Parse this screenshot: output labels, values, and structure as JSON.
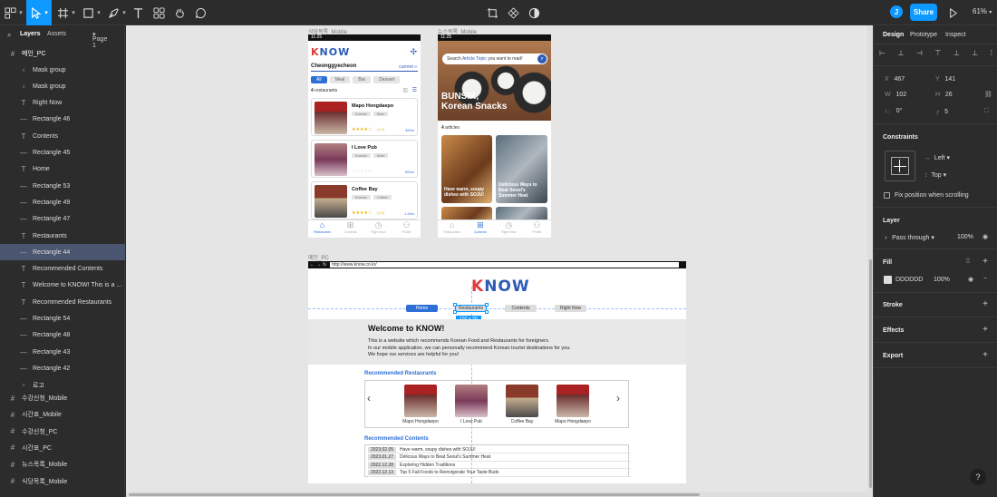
{
  "toolbar": {
    "share_label": "Share",
    "zoom": "61%",
    "avatar_letter": "J"
  },
  "left_panel": {
    "tabs": {
      "layers": "Layers",
      "assets": "Assets",
      "page": "Page 1"
    },
    "root_frame": "메인_PC",
    "layers": [
      {
        "label": "Mask group",
        "icon": "mask-icon"
      },
      {
        "label": "Mask group",
        "icon": "mask-icon"
      },
      {
        "label": "Right Now",
        "icon": "text-icon"
      },
      {
        "label": "Rectangle 46",
        "icon": "rect-icon"
      },
      {
        "label": "Contents",
        "icon": "text-icon"
      },
      {
        "label": "Rectangle 45",
        "icon": "rect-icon"
      },
      {
        "label": "Home",
        "icon": "text-icon"
      },
      {
        "label": "Rectangle 53",
        "icon": "rect-icon"
      },
      {
        "label": "Rectangle 49",
        "icon": "rect-icon"
      },
      {
        "label": "Rectangle 47",
        "icon": "rect-icon"
      },
      {
        "label": "Restaurants",
        "icon": "text-icon"
      },
      {
        "label": "Rectangle 44",
        "icon": "rect-icon",
        "selected": true
      },
      {
        "label": "Recommended Contents",
        "icon": "text-icon"
      },
      {
        "label": "Welcome to KNOW! This is a ...",
        "icon": "text-icon"
      },
      {
        "label": "Recommended Restaurants",
        "icon": "text-icon"
      },
      {
        "label": "Rectangle 54",
        "icon": "rect-icon"
      },
      {
        "label": "Rectangle 48",
        "icon": "rect-icon"
      },
      {
        "label": "Rectangle 43",
        "icon": "rect-icon"
      },
      {
        "label": "Rectangle 42",
        "icon": "rect-icon"
      },
      {
        "label": "로고",
        "icon": "mask-icon"
      }
    ],
    "frames": [
      "수강신청_Mobile",
      "시간표_Mobile",
      "수강신청_PC",
      "시간표_PC",
      "뉴스목록_Mobile",
      "식당목록_Mobile"
    ]
  },
  "canvas": {
    "mobile1_label": "식당목록_Mobile",
    "mobile2_label": "뉴스목록_Mobile",
    "pc_label": "메인_PC",
    "time": "11:25",
    "mobile1": {
      "logo": "KNOW",
      "location": "Cheonggyecheon",
      "current": "current",
      "filters": [
        "All",
        "Meal",
        "Bar",
        "Dessert"
      ],
      "count_num": "4",
      "count_text": "restaurants",
      "restaurants": [
        {
          "name": "Mapo Hongdaepo",
          "tags": [
            "Korean",
            "Beer"
          ],
          "rating": "(4.0)",
          "dist": "300m"
        },
        {
          "name": "I Love Pub",
          "tags": [
            "Korean",
            "Beer"
          ],
          "rating": "",
          "dist": "600m"
        },
        {
          "name": "Coffee Bay",
          "tags": [
            "Korean",
            "Coffee"
          ],
          "rating": "(3.0)",
          "dist": "1.2km"
        }
      ],
      "tabbar": [
        "Restaurants",
        "Contents",
        "Right Now",
        "Profile"
      ]
    },
    "mobile2": {
      "search_pre": "Search",
      "search_hl": "Article Topic",
      "search_post": "you want to read!",
      "hero_title_1": "BUNSIK,",
      "hero_title_2": "Korean Snacks",
      "count_num": "4",
      "count_text": "articles",
      "articles": [
        "Have warm, soupy dishes with SOJU!",
        "Delicious Ways to Beat Seoul's Summer Heat"
      ],
      "tabbar": [
        "Restaurants",
        "Contents",
        "Right Now",
        "Profile"
      ]
    },
    "pc": {
      "url": "http://www.know.co.kr/",
      "logo": "KNOW",
      "nav": [
        "Home",
        "Restaurants",
        "Contents",
        "Right Now"
      ],
      "selection_size": "102 × 26",
      "welcome_title": "Welcome to KNOW!",
      "welcome_lines": [
        "This is a website which recommends Korean Food and Restaurants for foreigners.",
        "In our mobile application, we can personally recommend Korean tourist destinations for you.",
        "We hope our services are helpful for you!"
      ],
      "rec_restaurants_title": "Recommended Restaurants",
      "restaurants": [
        "Mapo Hongdaepo",
        "I Love Pub",
        "Coffee Bay",
        "Mapo Hongdaepo"
      ],
      "rec_contents_title": "Recommended Contents",
      "news": [
        {
          "date": "2023.02.05",
          "title": "Have warm, soupy dishes with SOJU!"
        },
        {
          "date": "2023.01.27",
          "title": "Delicous Ways to Beat Seoul's Summer Heat"
        },
        {
          "date": "2022.12.28",
          "title": "Exploring Hidden Traditions"
        },
        {
          "date": "2022.12.13",
          "title": "Top 5 Fall Foods to Reinvigorate Your Taste Buds"
        }
      ]
    }
  },
  "right_panel": {
    "tabs": [
      "Design",
      "Prototype",
      "Inspect"
    ],
    "x_label": "X",
    "x": "467",
    "y_label": "Y",
    "y": "141",
    "w_label": "W",
    "w": "102",
    "h_label": "H",
    "h": "26",
    "rotation": "0°",
    "radius": "5",
    "constraints_title": "Constraints",
    "constraint_h": "Left",
    "constraint_v": "Top",
    "fix_position": "Fix position when scrolling",
    "layer_title": "Layer",
    "blend": "Pass through",
    "layer_opacity": "100%",
    "fill_title": "Fill",
    "fill_hex": "DDDDDD",
    "fill_opacity": "100%",
    "fill_color": "#dddddd",
    "stroke_title": "Stroke",
    "effects_title": "Effects",
    "export_title": "Export",
    "help": "?"
  },
  "colors": {
    "accent": "#0d99ff",
    "brand_red": "#e03a3a",
    "brand_blue": "#2d5bb5",
    "selection_bg": "#4a5570"
  }
}
